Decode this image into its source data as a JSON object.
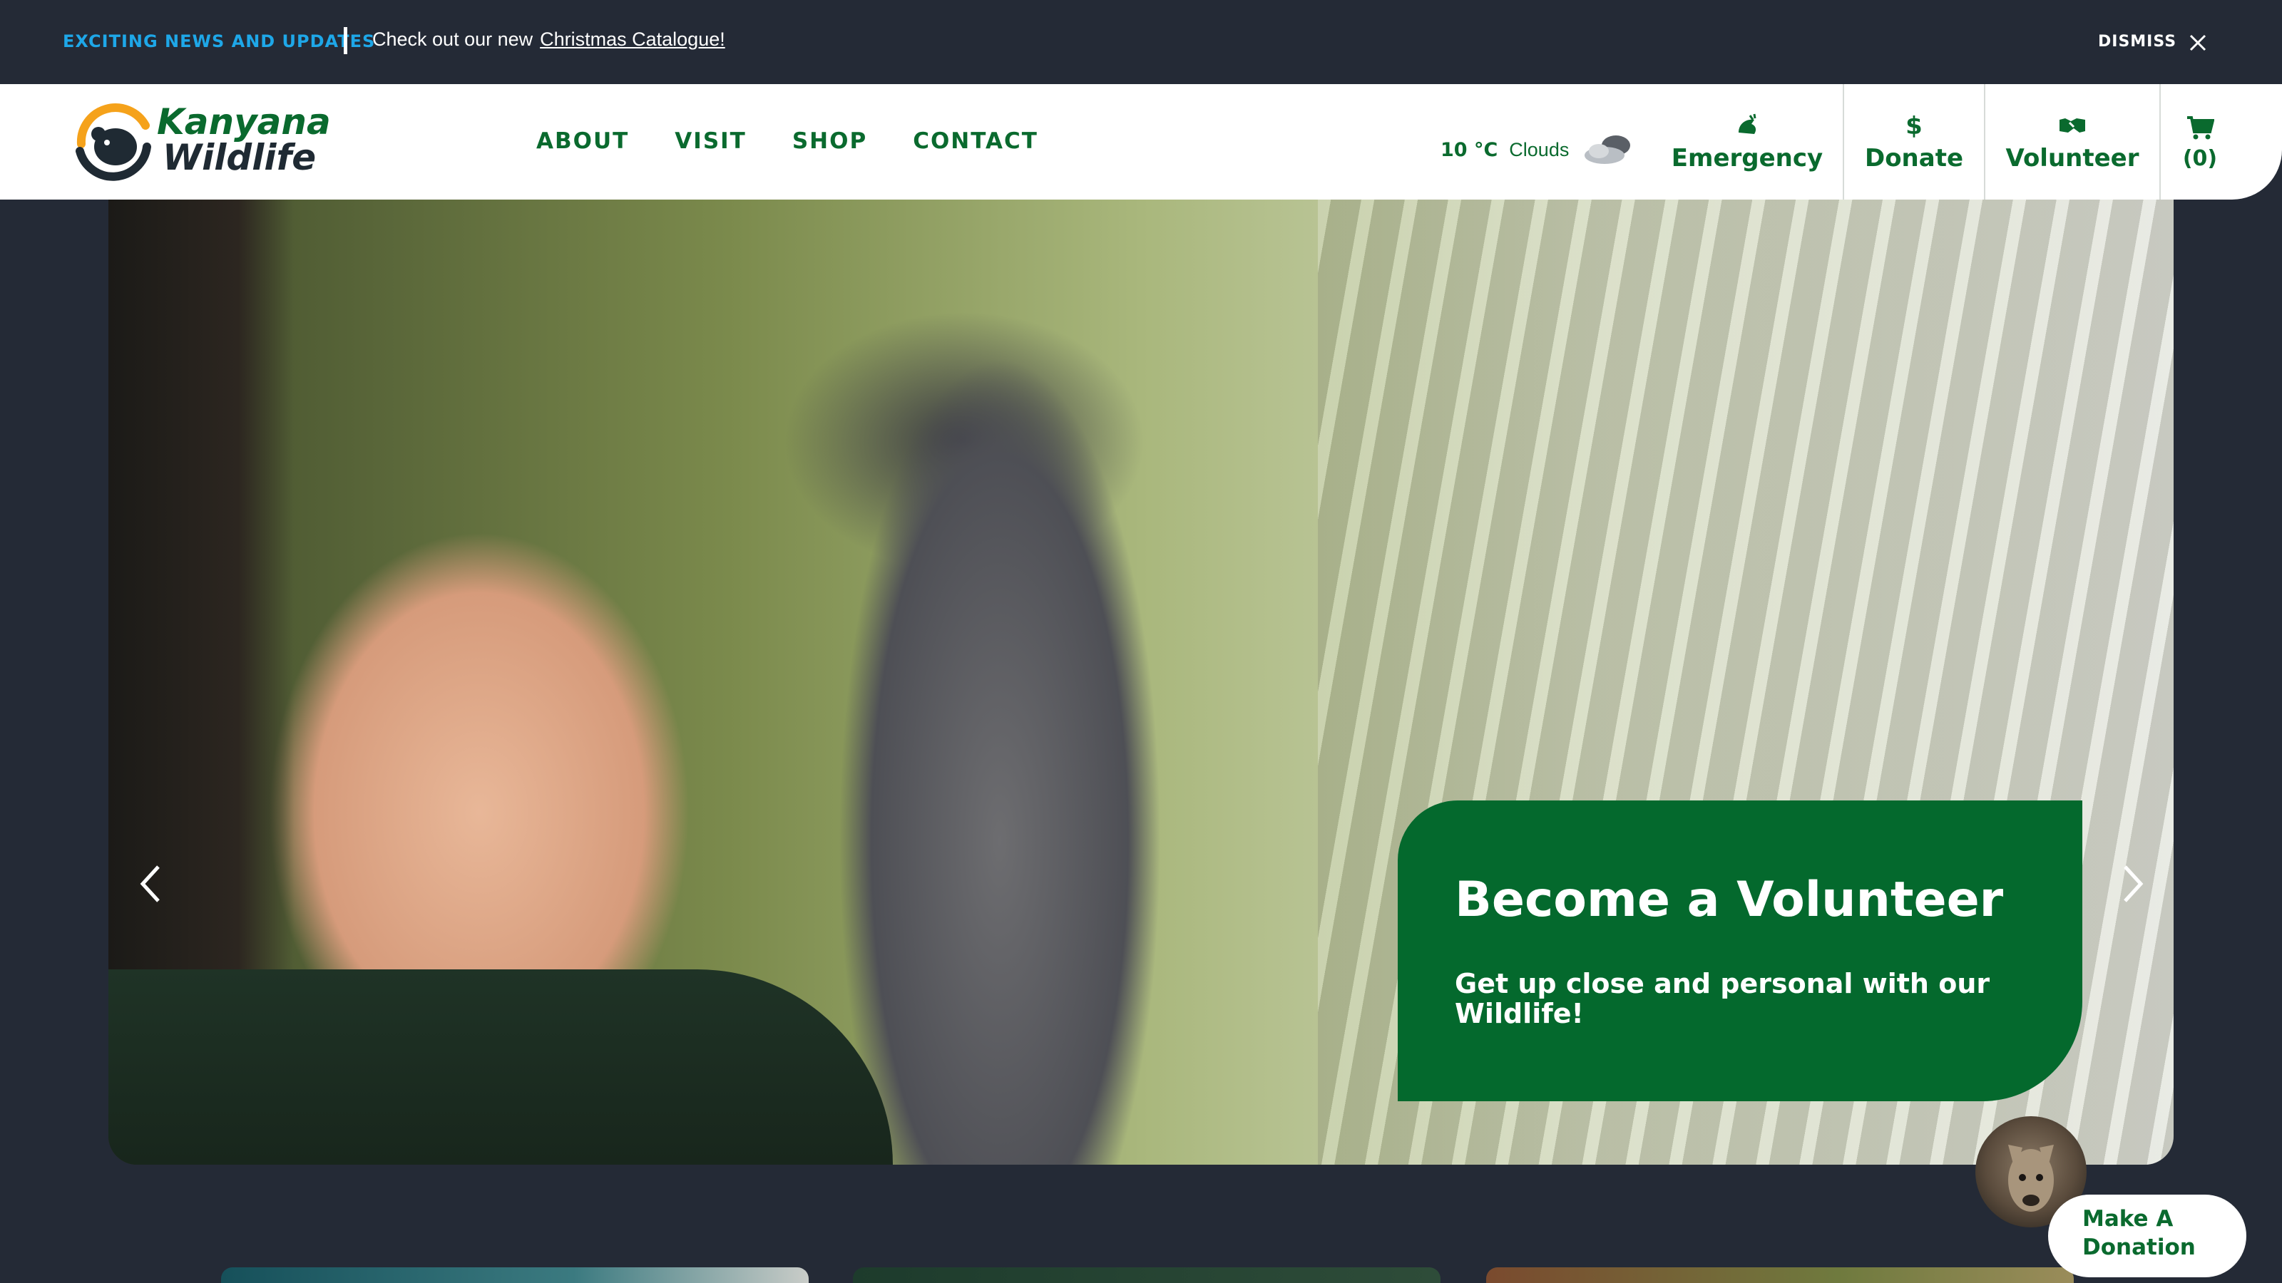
{
  "announcement": {
    "tag": "EXCITING NEWS AND UPDATES",
    "message": "Check out our new",
    "link": "Christmas Catalogue!",
    "dismiss": "DISMISS"
  },
  "logo": {
    "line1": "Kanyana",
    "line2": "Wildlife"
  },
  "nav": [
    "ABOUT",
    "VISIT",
    "SHOP",
    "CONTACT"
  ],
  "weather": {
    "temp": "10 °C",
    "condition": "Clouds",
    "icon": "cloud-icon"
  },
  "header_buttons": {
    "emergency": "Emergency",
    "donate": "Donate",
    "volunteer": "Volunteer",
    "cart": "(0)"
  },
  "hero": {
    "title": "Become a Volunteer",
    "subtitle": "Get up close and personal with our Wildlife!"
  },
  "donation_widget": {
    "label_line1": "Make A",
    "label_line2": "Donation"
  },
  "colors": {
    "brand_green": "#04692d",
    "accent_blue": "#1ea7e8",
    "bg_dark": "#242a36"
  }
}
